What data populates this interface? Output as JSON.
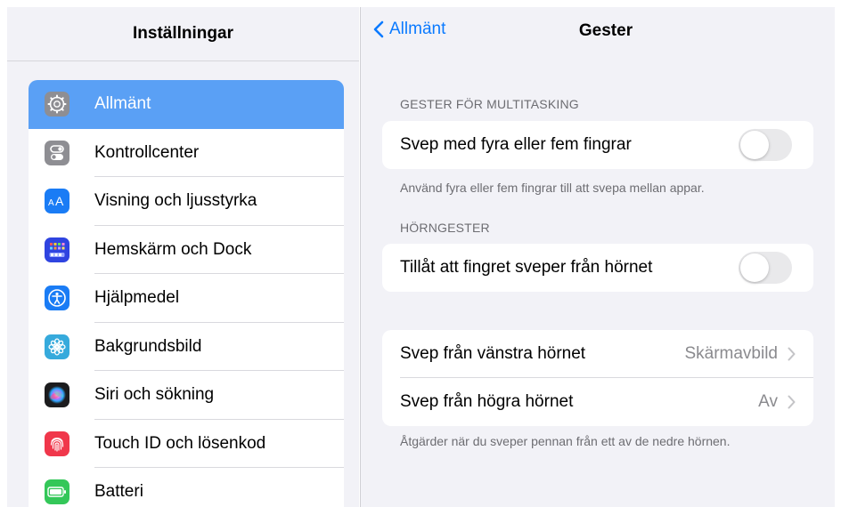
{
  "sidebar": {
    "title": "Inställningar",
    "items": [
      {
        "label": "Allmänt",
        "icon": "gear-icon",
        "color": "#8e8e93",
        "selected": true
      },
      {
        "label": "Kontrollcenter",
        "icon": "switches-icon",
        "color": "#8e8e93"
      },
      {
        "label": "Visning och ljusstyrka",
        "icon": "text-size-icon",
        "color": "#1a7cf5"
      },
      {
        "label": "Hemskärm och Dock",
        "icon": "app-grid-icon",
        "color": "#2f44e0"
      },
      {
        "label": "Hjälpmedel",
        "icon": "accessibility-icon",
        "color": "#1a7cf5"
      },
      {
        "label": "Bakgrundsbild",
        "icon": "flower-icon",
        "color": "#36aadc"
      },
      {
        "label": "Siri och sökning",
        "icon": "siri-icon",
        "color": "#1c1c1e"
      },
      {
        "label": "Touch ID och lösenkod",
        "icon": "fingerprint-icon",
        "color": "#f0374b"
      },
      {
        "label": "Batteri",
        "icon": "battery-icon",
        "color": "#34c759"
      }
    ]
  },
  "detail": {
    "back_label": "Allmänt",
    "title": "Gester",
    "multitasking_header": "GESTER FÖR MULTITASKING",
    "four_five_fingers_label": "Svep med fyra eller fem fingrar",
    "four_five_fingers_on": false,
    "multitasking_footer": "Använd fyra eller fem fingrar till att svepa mellan appar.",
    "corner_header": "HÖRNGESTER",
    "allow_corner_label": "Tillåt att fingret sveper från hörnet",
    "allow_corner_on": false,
    "left_corner_label": "Svep från vänstra hörnet",
    "left_corner_value": "Skärmavbild",
    "right_corner_label": "Svep från högra hörnet",
    "right_corner_value": "Av",
    "corner_footer": "Åtgärder när du sveper pennan från ett av de nedre hörnen."
  },
  "colors": {
    "accent": "#0a7aff",
    "selected_row": "#5aa0f5",
    "toggle_off": "#e9e9eb"
  }
}
